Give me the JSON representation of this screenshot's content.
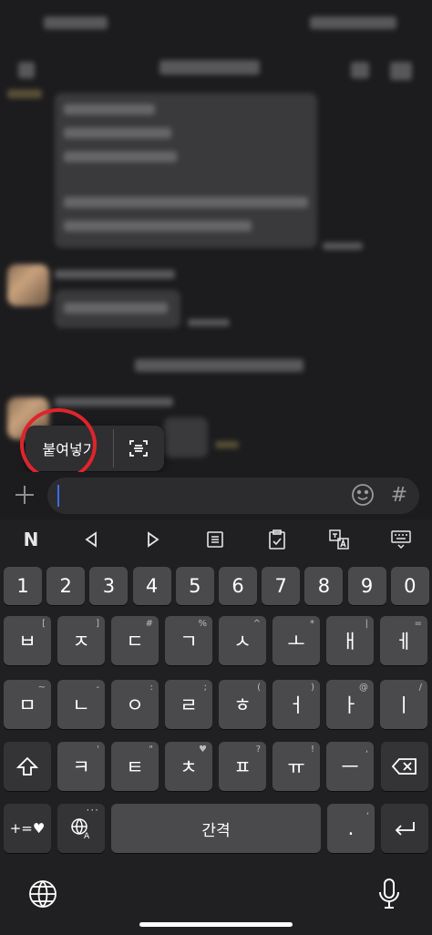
{
  "paste_popup": {
    "paste_label": "붙여넣기",
    "scan_icon": "text-scan-icon"
  },
  "input": {
    "add_icon": "plus-icon",
    "emoji_icon": "emoji-icon",
    "hashtag_label": "#"
  },
  "toolbar": {
    "logo_label": "N",
    "items": [
      "left-arrow-icon",
      "right-arrow-icon",
      "memo-icon",
      "clipboard-icon",
      "translate-icon",
      "keyboard-hide-icon"
    ]
  },
  "keyboard": {
    "number_row": [
      "1",
      "2",
      "3",
      "4",
      "5",
      "6",
      "7",
      "8",
      "9",
      "0"
    ],
    "row1": [
      {
        "label": "ㅂ",
        "hint": "["
      },
      {
        "label": "ㅈ",
        "hint": "]"
      },
      {
        "label": "ㄷ",
        "hint": "#"
      },
      {
        "label": "ㄱ",
        "hint": "%"
      },
      {
        "label": "ㅅ",
        "hint": "^"
      },
      {
        "label": "ㅗ",
        "hint": "*"
      },
      {
        "label": "ㅐ",
        "hint": "|"
      },
      {
        "label": "ㅔ",
        "hint": "="
      }
    ],
    "row2": [
      {
        "label": "ㅁ",
        "hint": "~"
      },
      {
        "label": "ㄴ",
        "hint": "-"
      },
      {
        "label": "ㅇ",
        "hint": ":"
      },
      {
        "label": "ㄹ",
        "hint": ";"
      },
      {
        "label": "ㅎ",
        "hint": "("
      },
      {
        "label": "ㅓ",
        "hint": ")"
      },
      {
        "label": "ㅏ",
        "hint": "@"
      },
      {
        "label": "ㅣ",
        "hint": "/"
      }
    ],
    "row3": [
      {
        "label": "ㅋ",
        "hint": "'"
      },
      {
        "label": "ㅌ",
        "hint": "\""
      },
      {
        "label": "ㅊ",
        "hint": "♥"
      },
      {
        "label": "ㅍ",
        "hint": "?"
      },
      {
        "label": "ㅠ",
        "hint": "!"
      },
      {
        "label": "ㅡ",
        "hint": ","
      }
    ],
    "symbols_label": "+=♥",
    "space_label": "간격",
    "period_label": ".",
    "period_hint": ","
  },
  "bottom": {
    "globe_icon": "globe-icon",
    "mic_icon": "microphone-icon"
  }
}
